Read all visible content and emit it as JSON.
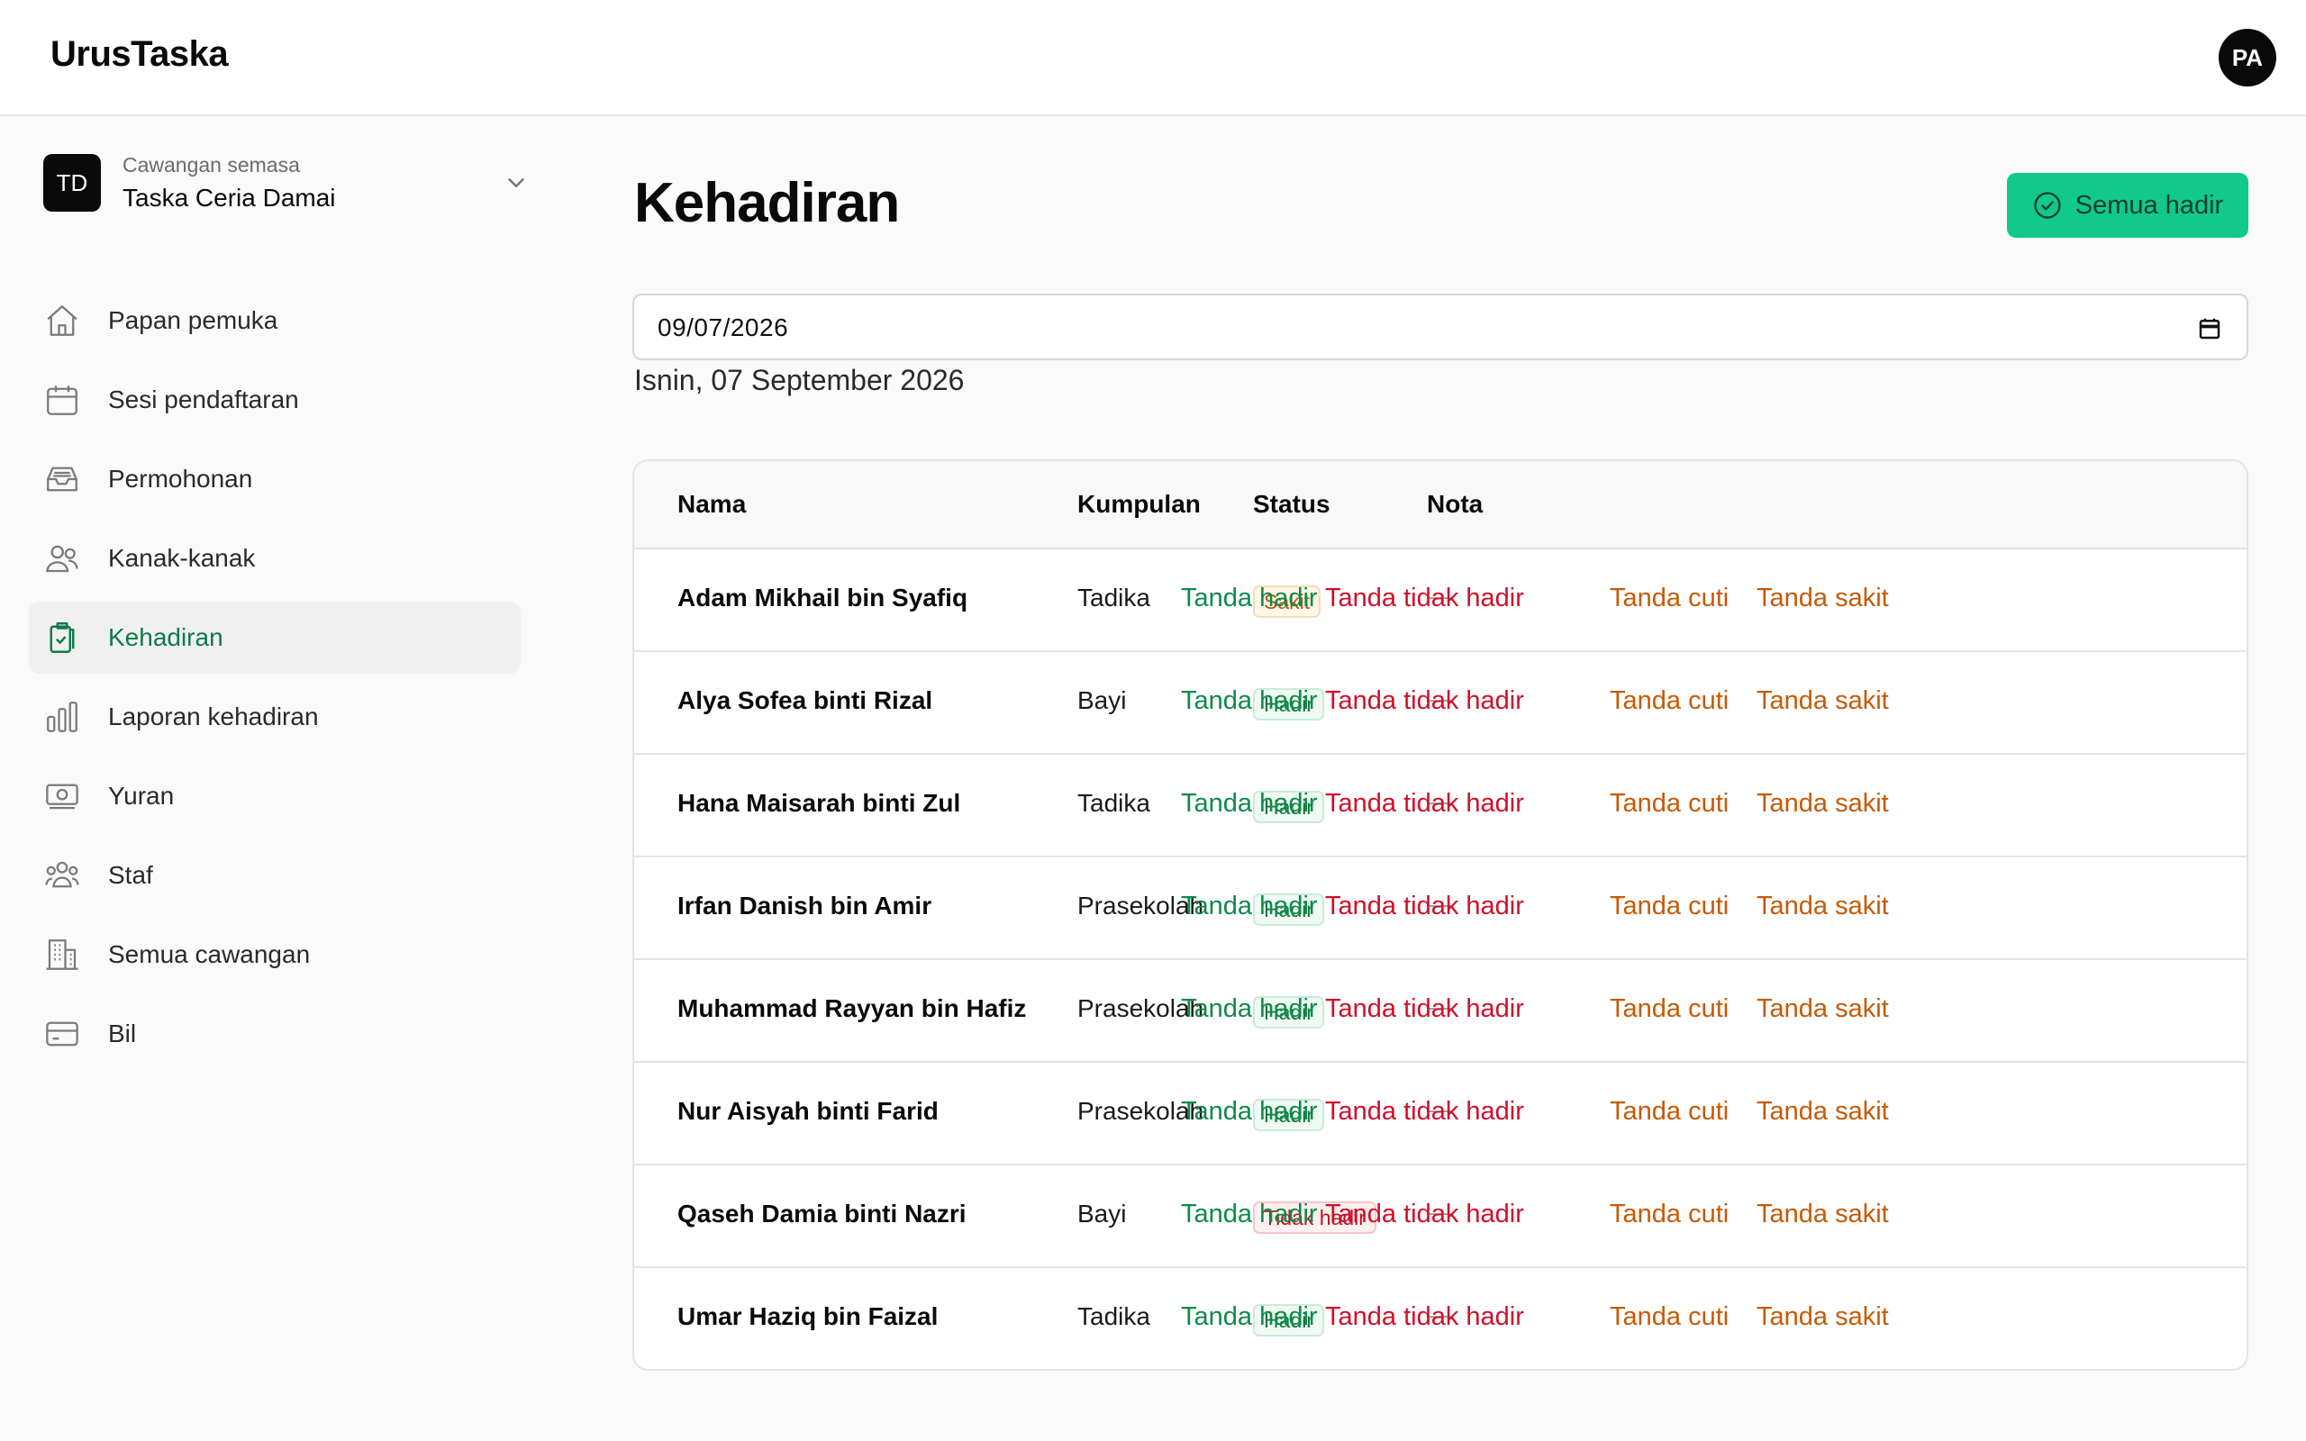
{
  "app": {
    "brand": "UrusTaska",
    "user_initials": "PA"
  },
  "branch": {
    "initials": "TD",
    "caption": "Cawangan semasa",
    "name": "Taska Ceria Damai"
  },
  "sidebar": {
    "items": [
      {
        "label": "Papan pemuka",
        "icon": "home-icon"
      },
      {
        "label": "Sesi pendaftaran",
        "icon": "calendar-icon"
      },
      {
        "label": "Permohonan",
        "icon": "inbox-icon"
      },
      {
        "label": "Kanak-kanak",
        "icon": "users-icon"
      },
      {
        "label": "Kehadiran",
        "icon": "clipboard-check-icon",
        "active": true
      },
      {
        "label": "Laporan kehadiran",
        "icon": "bar-chart-icon"
      },
      {
        "label": "Yuran",
        "icon": "banknote-icon"
      },
      {
        "label": "Staf",
        "icon": "team-icon"
      },
      {
        "label": "Semua cawangan",
        "icon": "building-icon"
      },
      {
        "label": "Bil",
        "icon": "credit-card-icon"
      }
    ]
  },
  "main": {
    "title": "Kehadiran",
    "all_present_label": "Semua hadir",
    "date_value": "09/07/2026",
    "date_long": "Isnin, 07 September 2026",
    "columns": {
      "name": "Nama",
      "group": "Kumpulan",
      "status": "Status",
      "note": "Nota"
    },
    "actions": {
      "present": "Tanda hadir",
      "absent": "Tanda tidak hadir",
      "leave": "Tanda cuti",
      "sick": "Tanda sakit"
    },
    "rows": [
      {
        "name": "Adam Mikhail bin Syafiq",
        "group": "Tadika",
        "status": "Sakit",
        "status_type": "sakit",
        "note": "—"
      },
      {
        "name": "Alya Sofea binti Rizal",
        "group": "Bayi",
        "status": "Hadir",
        "status_type": "hadir",
        "note": "—"
      },
      {
        "name": "Hana Maisarah binti Zul",
        "group": "Tadika",
        "status": "Hadir",
        "status_type": "hadir",
        "note": "—"
      },
      {
        "name": "Irfan Danish bin Amir",
        "group": "Prasekolah",
        "status": "Hadir",
        "status_type": "hadir",
        "note": "—"
      },
      {
        "name": "Muhammad Rayyan bin Hafiz",
        "group": "Prasekolah",
        "status": "Hadir",
        "status_type": "hadir",
        "note": "—"
      },
      {
        "name": "Nur Aisyah binti Farid",
        "group": "Prasekolah",
        "status": "Hadir",
        "status_type": "hadir",
        "note": "—"
      },
      {
        "name": "Qaseh Damia binti Nazri",
        "group": "Bayi",
        "status": "Tidak hadir",
        "status_type": "tidak",
        "note": "—"
      },
      {
        "name": "Umar Haziq bin Faizal",
        "group": "Tadika",
        "status": "Hadir",
        "status_type": "hadir",
        "note": "—"
      }
    ]
  },
  "colors": {
    "accent_green": "#0e7a4a",
    "button_green": "#10c98a",
    "action_red": "#d10f2a",
    "action_orange": "#c65a05"
  }
}
